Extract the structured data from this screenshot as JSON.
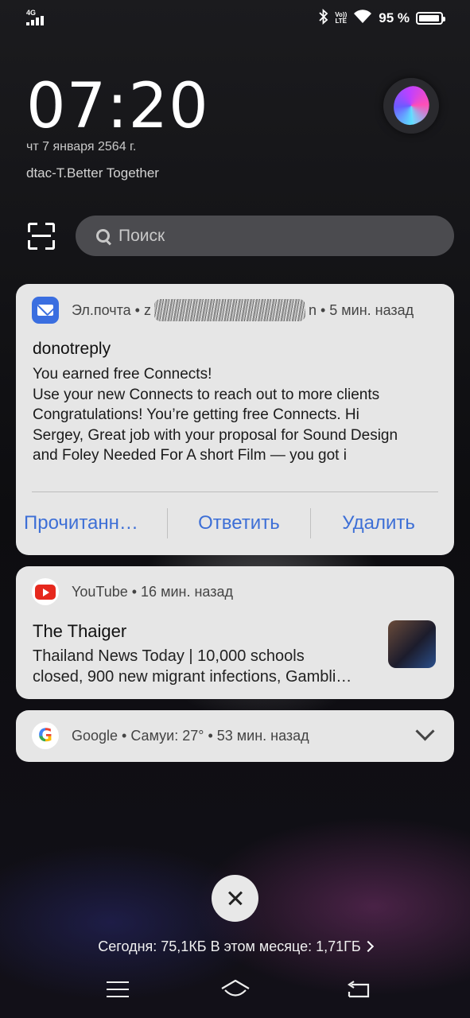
{
  "status_bar": {
    "network": "4G",
    "volte_line1": "Vo))",
    "volte_line2": "LTE",
    "battery": "95 %",
    "battery_level": 0.95,
    "icons": [
      "signal-icon",
      "bluetooth-icon",
      "wifi-icon",
      "battery-icon"
    ]
  },
  "lockscreen": {
    "time": "07:20",
    "date": "чт 7 января 2564 г.",
    "carrier": "dtac-T.Better Together"
  },
  "search": {
    "placeholder": "Поиск"
  },
  "notifications": {
    "email": {
      "app": "Эл.почта",
      "account_prefix": "z",
      "account_suffix": "n",
      "time": "5 мин. назад",
      "sender": "donotreply",
      "body_lines": [
        "You earned free Connects!",
        "Use your new Connects to reach out to more clients",
        "Congratulations! You’re getting free Connects. Hi",
        "Sergey, Great job with your proposal for Sound Design",
        "and Foley Needed For A short Film — you got i"
      ],
      "actions": {
        "mark_read": "Прочитанн…",
        "reply": "Ответить",
        "delete": "Удалить"
      },
      "accent": "#3d6fd6"
    },
    "youtube": {
      "app": "YouTube",
      "time": "16 мин. назад",
      "title": "The Thaiger",
      "body_lines": [
        "Thailand News Today | 10,000 schools",
        "closed, 900 new migrant infections, Gambli…"
      ]
    },
    "google": {
      "app": "Google",
      "weather": "Самуи: 27°",
      "time": "53 мин. назад"
    }
  },
  "footer": {
    "data_usage": "Сегодня: 75,1КБ В этом месяце: 1,71ГБ"
  }
}
